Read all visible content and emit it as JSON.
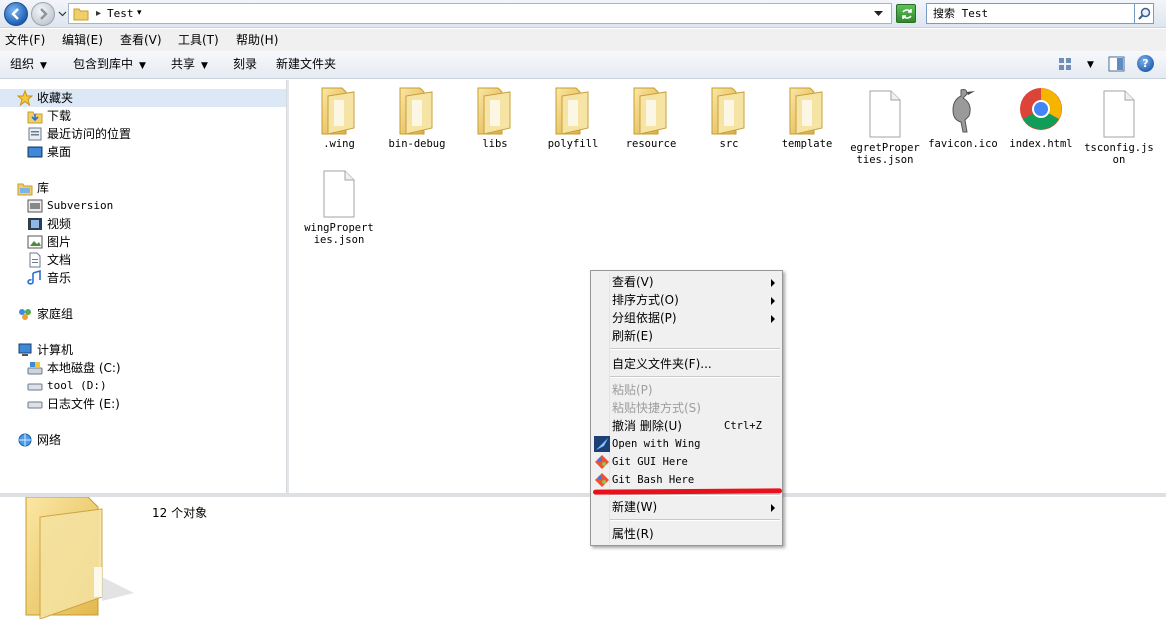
{
  "window": {
    "address_path": "Test",
    "search_placeholder": "搜索 Test"
  },
  "menubar": [
    {
      "label": "文件(F)"
    },
    {
      "label": "编辑(E)"
    },
    {
      "label": "查看(V)"
    },
    {
      "label": "工具(T)"
    },
    {
      "label": "帮助(H)"
    }
  ],
  "toolbar": {
    "organize": "组织",
    "include_library": "包含到库中",
    "share": "共享",
    "burn": "刻录",
    "new_folder": "新建文件夹"
  },
  "navpane": {
    "favorites": "收藏夹",
    "downloads": "下载",
    "recent_places": "最近访问的位置",
    "desktop": "桌面",
    "libraries": "库",
    "subversion": "Subversion",
    "videos": "视频",
    "pictures": "图片",
    "documents": "文档",
    "music": "音乐",
    "homegroup": "家庭组",
    "computer": "计算机",
    "local_disk": "本地磁盘 (C:)",
    "tool_drive": "tool (D:)",
    "log_drive": "日志文件 (E:)",
    "network": "网络"
  },
  "files": [
    {
      "name": ".wing",
      "icon": "folder-icon"
    },
    {
      "name": "bin-debug",
      "icon": "folder-icon"
    },
    {
      "name": "libs",
      "icon": "folder-icon"
    },
    {
      "name": "polyfill",
      "icon": "folder-icon"
    },
    {
      "name": "resource",
      "icon": "folder-icon"
    },
    {
      "name": "src",
      "icon": "folder-icon"
    },
    {
      "name": "template",
      "icon": "folder-icon"
    },
    {
      "name": "egretProperties.json",
      "icon": "file-icon"
    },
    {
      "name": "favicon.ico",
      "icon": "bird-image-icon"
    },
    {
      "name": "index.html",
      "icon": "chrome-icon"
    },
    {
      "name": "tsconfig.json",
      "icon": "file-icon"
    },
    {
      "name": "wingProperties.json",
      "icon": "file-icon"
    }
  ],
  "details": {
    "count": "12 个对象"
  },
  "context_menu": {
    "view": "查看(V)",
    "sort_by": "排序方式(O)",
    "group_by": "分组依据(P)",
    "refresh": "刷新(E)",
    "customize_folder": "自定义文件夹(F)...",
    "paste": "粘贴(P)",
    "paste_shortcut": "粘贴快捷方式(S)",
    "undo_delete": "撤消 删除(U)",
    "undo_shortcut": "Ctrl+Z",
    "open_with_wing": "Open with Wing",
    "git_gui": "Git GUI Here",
    "git_bash": "Git Bash Here",
    "new": "新建(W)",
    "properties": "属性(R)"
  },
  "colors": {
    "highlight_underline": "#e8101a",
    "selection": "#dce8f6"
  }
}
